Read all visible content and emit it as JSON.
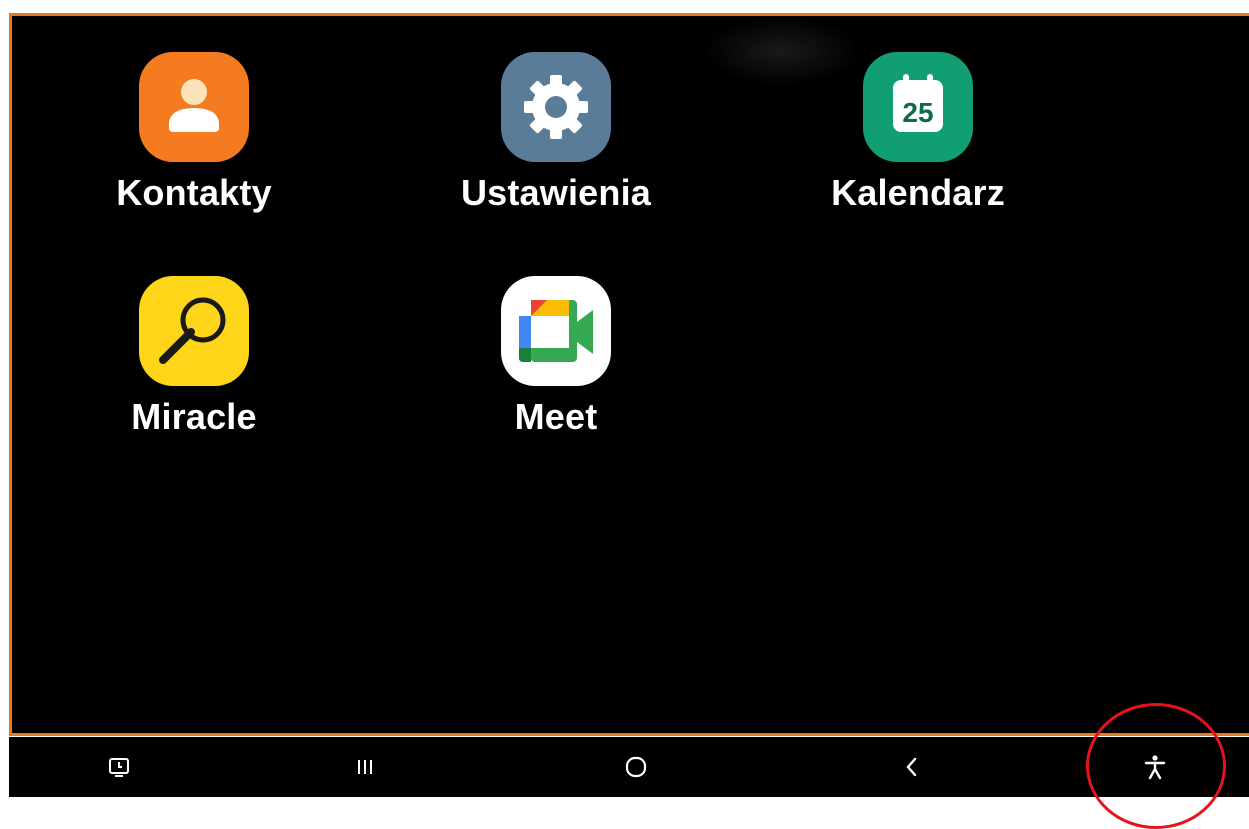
{
  "apps": [
    {
      "label": "Kontakty",
      "icon": "person-icon",
      "color": "#f47b20"
    },
    {
      "label": "Ustawienia",
      "icon": "gear-icon",
      "color": "#5b7c99"
    },
    {
      "label": "Kalendarz",
      "icon": "calendar-icon",
      "color": "#129e73",
      "date": "25"
    },
    {
      "label": "Miracle",
      "icon": "magnifier-icon",
      "color": "#ffd51a"
    },
    {
      "label": "Meet",
      "icon": "google-meet-icon",
      "color": "#ffffff"
    }
  ],
  "navbar": {
    "items": [
      "screen-time-icon",
      "recent-apps-icon",
      "home-icon",
      "back-icon",
      "accessibility-icon"
    ]
  },
  "colors": {
    "screen_border": "#e87a1c",
    "highlight_circle": "#e4141b"
  }
}
